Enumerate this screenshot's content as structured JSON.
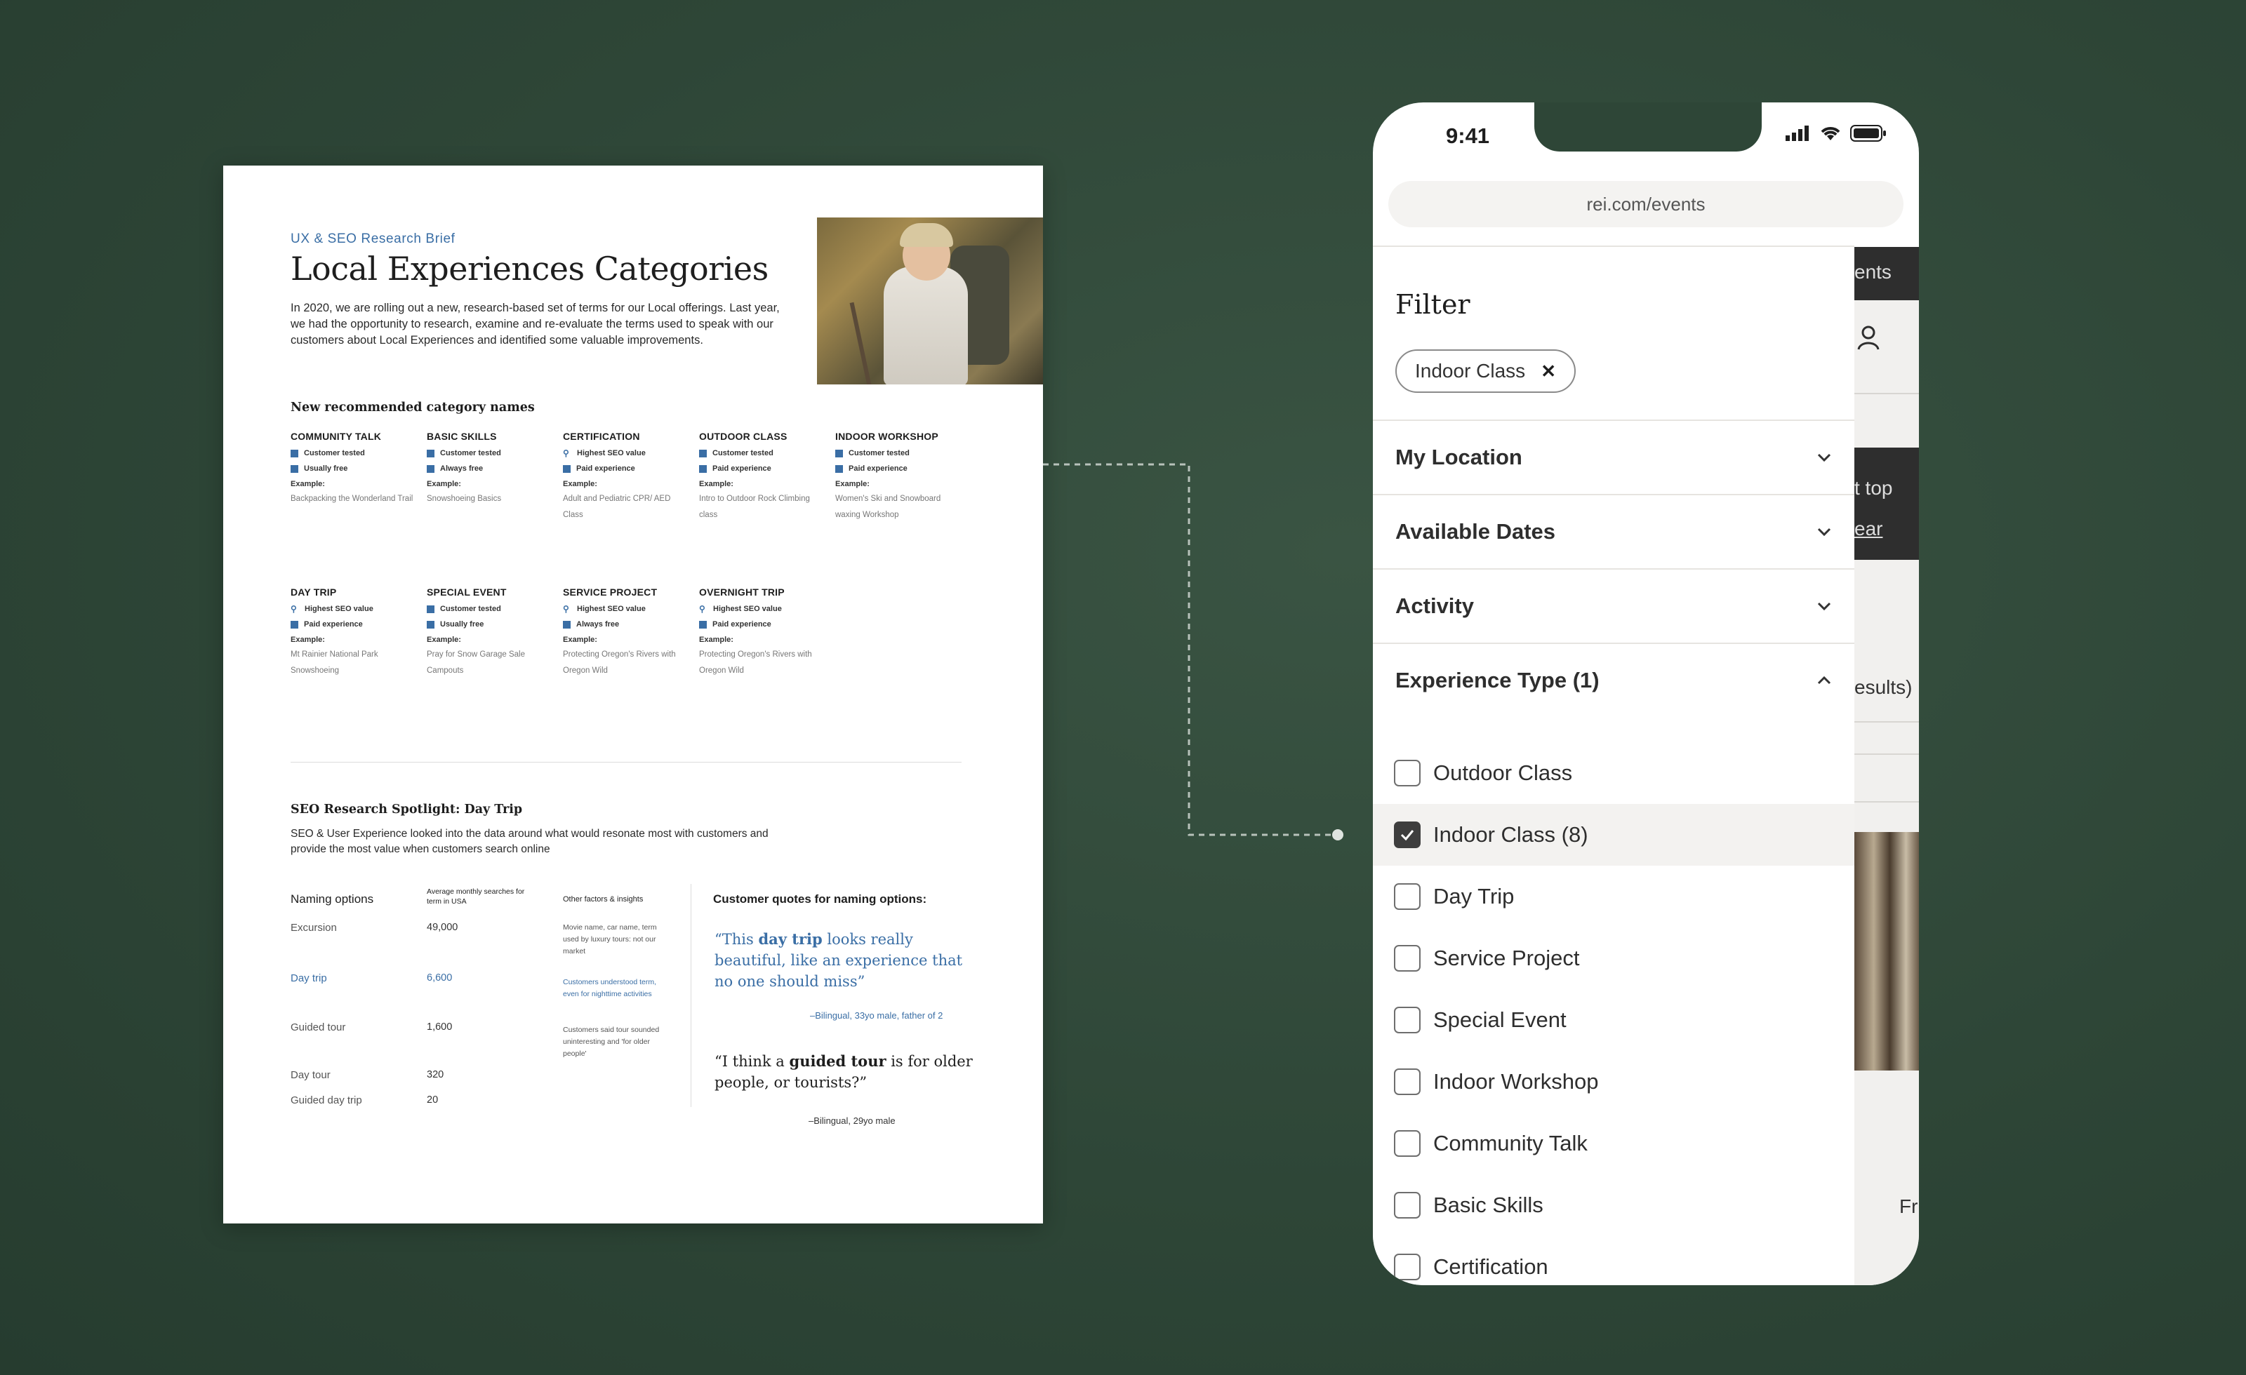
{
  "doc": {
    "eyebrow": "UX & SEO Research Brief",
    "title": "Local Experiences Categories",
    "intro": "In 2020, we are rolling out a new, research-based set of terms for our Local offerings. Last year, we had the opportunity to research, examine and re-evaluate the terms used to speak with our customers about Local Experiences and identified some valuable improvements.",
    "subhead": "New recommended category names",
    "example_label": "Example:",
    "categories": [
      {
        "name": "COMMUNITY TALK",
        "t1": "Customer tested",
        "t2": "Usually free",
        "ex": "Backpacking the Wonderland Trail"
      },
      {
        "name": "BASIC SKILLS",
        "t1": "Customer tested",
        "t2": "Always free",
        "ex": "Snowshoeing Basics"
      },
      {
        "name": "CERTIFICATION",
        "t1": "Highest SEO value",
        "t2": "Paid experience",
        "ex": "Adult and Pediatric CPR/ AED Class"
      },
      {
        "name": "OUTDOOR CLASS",
        "t1": "Customer tested",
        "t2": "Paid experience",
        "ex": "Intro to Outdoor Rock Climbing class"
      },
      {
        "name": "INDOOR WORKSHOP",
        "t1": "Customer tested",
        "t2": "Paid experience",
        "ex": "Women's Ski and Snowboard waxing Workshop"
      },
      {
        "name": "DAY TRIP",
        "t1": "Highest SEO value",
        "t2": "Paid experience",
        "ex": "Mt Rainier National Park Snowshoeing"
      },
      {
        "name": "SPECIAL EVENT",
        "t1": "Customer tested",
        "t2": "Usually free",
        "ex": "Pray for Snow Garage Sale Campouts"
      },
      {
        "name": "SERVICE PROJECT",
        "t1": "Highest SEO value",
        "t2": "Always free",
        "ex": "Protecting Oregon's Rivers with Oregon Wild"
      },
      {
        "name": "OVERNIGHT TRIP",
        "t1": "Highest SEO value",
        "t2": "Paid experience",
        "ex": "Protecting Oregon's Rivers with Oregon Wild"
      }
    ],
    "spotlight_title": "SEO Research Spotlight: Day Trip",
    "spotlight_intro": "SEO & User Experience looked into the data around what would resonate most with customers and provide the most value when customers search online",
    "table_headers": {
      "naming": "Naming options",
      "searches": "Average monthly searches for term in USA",
      "other": "Other factors & insights"
    },
    "rows": [
      {
        "option": "Excursion",
        "searches": "49,000",
        "note": "Movie name, car name, term used by luxury tours: not our market"
      },
      {
        "option": "Day trip",
        "searches": "6,600",
        "note": "Customers understood term, even for nighttime activities"
      },
      {
        "option": "Guided tour",
        "searches": "1,600",
        "note": "Customers said tour sounded uninteresting and 'for older people'"
      },
      {
        "option": "Day tour",
        "searches": "320",
        "note": ""
      },
      {
        "option": "Guided day trip",
        "searches": "20",
        "note": ""
      }
    ],
    "quotes_head": "Customer quotes for naming options:",
    "quote1_pre": "“This ",
    "quote1_bold": "day trip",
    "quote1_post": " looks really beautiful, like an experience that no one should miss”",
    "quote1_attr": "–Bilingual, 33yo male, father of 2",
    "quote2_pre": "“I think a ",
    "quote2_bold": "guided tour",
    "quote2_post": " is for older people, or tourists?”",
    "quote2_attr": "–Bilingual, 29yo male"
  },
  "phone": {
    "time": "9:41",
    "url": "rei.com/events",
    "filter_title": "Filter",
    "chip_label": "Indoor Class",
    "accordions": [
      "My Location",
      "Available Dates",
      "Activity",
      "Experience Type (1)"
    ],
    "options": [
      {
        "label": "Outdoor Class",
        "checked": false
      },
      {
        "label": "Indoor Class (8)",
        "checked": true
      },
      {
        "label": "Day Trip",
        "checked": false
      },
      {
        "label": "Service Project",
        "checked": false
      },
      {
        "label": "Special Event",
        "checked": false
      },
      {
        "label": "Indoor Workshop",
        "checked": false
      },
      {
        "label": "Community Talk",
        "checked": false
      },
      {
        "label": "Basic Skills",
        "checked": false
      },
      {
        "label": "Certification",
        "checked": false
      }
    ],
    "bg_text": {
      "events": "ents",
      "top": "t top",
      "clear": "ear",
      "results": "esults)",
      "fr": "Fr"
    }
  },
  "colors": {
    "accent_blue": "#3a6ea5",
    "bg_green": "#2e4637"
  }
}
